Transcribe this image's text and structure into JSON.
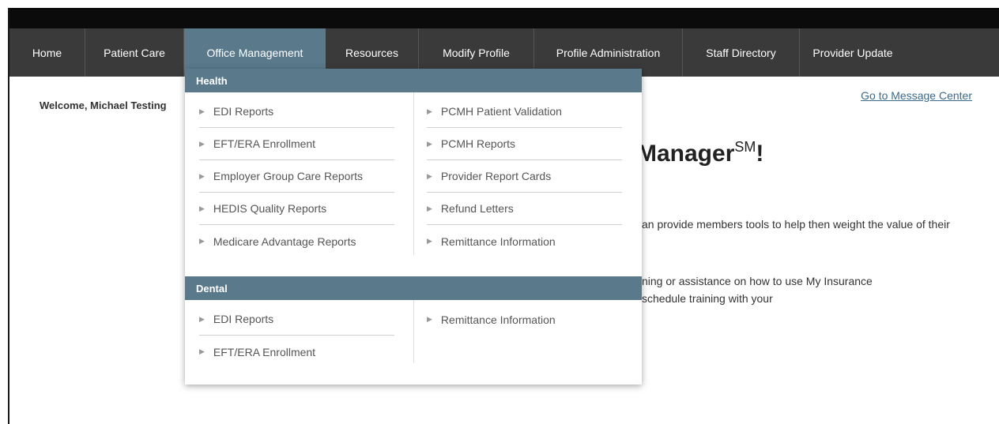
{
  "nav": {
    "items": [
      {
        "label": "Home",
        "active": false
      },
      {
        "label": "Patient Care",
        "active": false
      },
      {
        "label": "Office Management",
        "active": true
      },
      {
        "label": "Resources",
        "active": false
      },
      {
        "label": "Modify Profile",
        "active": false
      },
      {
        "label": "Profile Administration",
        "active": false
      },
      {
        "label": "Staff Directory",
        "active": false
      },
      {
        "label": "Provider Update",
        "active": false
      }
    ]
  },
  "page": {
    "welcome": "Welcome, Michael Testing",
    "message_center_link": "Go to Message Center",
    "hero_title": "Manager",
    "hero_superscript": "SM",
    "hero_suffix": "!",
    "line1": "an provide members tools to help then weight the value of their",
    "line2": "ning or assistance on how to use My Insurance",
    "line3": "schedule training with your"
  },
  "dropdown": {
    "health": {
      "header": "Health",
      "left": [
        "EDI Reports",
        "EFT/ERA Enrollment",
        "Employer Group Care Reports",
        "HEDIS Quality Reports",
        "Medicare Advantage Reports"
      ],
      "right": [
        "PCMH Patient Validation",
        "PCMH Reports",
        "Provider Report Cards",
        "Refund Letters",
        "Remittance Information"
      ]
    },
    "dental": {
      "header": "Dental",
      "left": [
        "EDI Reports",
        "EFT/ERA Enrollment"
      ],
      "right": [
        "Remittance Information"
      ]
    }
  },
  "colors": {
    "nav_bg": "#3a3a3a",
    "nav_active": "#5a7a8c",
    "section_header": "#5a7a8c",
    "link": "#3a6a8a"
  },
  "icons": {
    "menu_item_marker": "triangle-right-icon"
  }
}
